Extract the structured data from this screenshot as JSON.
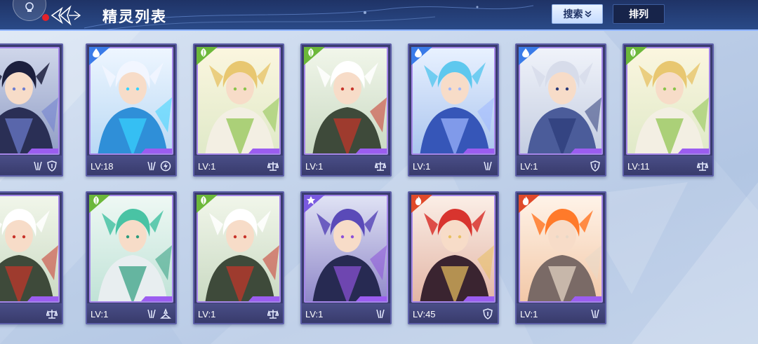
{
  "header": {
    "title": "精灵列表",
    "search_label": "搜索",
    "sort_label": "排列"
  },
  "colors": {
    "water": "#3a7be8",
    "grass": "#6cb83a",
    "dark": "#7a5ae0",
    "fire": "#e04a2a",
    "card_frame": "#5d5fa8"
  },
  "cards": [
    {
      "id": "c0",
      "level": "",
      "element": "none",
      "badges": [
        "trait-icon",
        "shield-icon"
      ],
      "art": "dark-knight"
    },
    {
      "id": "c1",
      "level": "LV:18",
      "element": "water",
      "badges": [
        "trait-icon",
        "lightning-icon"
      ],
      "art": "white-hair-elf"
    },
    {
      "id": "c2",
      "level": "LV:1",
      "element": "grass",
      "badges": [
        "balance-icon"
      ],
      "art": "blonde-fairy"
    },
    {
      "id": "c3",
      "level": "LV:1",
      "element": "grass",
      "badges": [
        "balance-icon"
      ],
      "art": "panda"
    },
    {
      "id": "c4",
      "level": "LV:1",
      "element": "water",
      "badges": [
        "trait-icon"
      ],
      "art": "blue-hair-swordsman"
    },
    {
      "id": "c5",
      "level": "LV:1",
      "element": "water",
      "badges": [
        "shield-icon"
      ],
      "art": "armored-knight"
    },
    {
      "id": "c6",
      "level": "LV:11",
      "element": "grass",
      "badges": [
        "balance-icon"
      ],
      "art": "blonde-fairy"
    },
    {
      "id": "c7",
      "level": "",
      "element": "none",
      "badges": [
        "balance-icon"
      ],
      "art": "panda"
    },
    {
      "id": "c8",
      "level": "LV:1",
      "element": "grass",
      "badges": [
        "trait-icon",
        "stance-icon"
      ],
      "art": "green-robot"
    },
    {
      "id": "c9",
      "level": "LV:1",
      "element": "grass",
      "badges": [
        "balance-icon"
      ],
      "art": "panda"
    },
    {
      "id": "c10",
      "level": "LV:1",
      "element": "dark",
      "badges": [
        "trait-icon"
      ],
      "art": "dark-dragon"
    },
    {
      "id": "c11",
      "level": "LV:45",
      "element": "fire",
      "badges": [
        "shield-icon"
      ],
      "art": "red-dragon"
    },
    {
      "id": "c12",
      "level": "LV:1",
      "element": "fire",
      "badges": [
        "trait-icon"
      ],
      "art": "flame-knight"
    }
  ]
}
